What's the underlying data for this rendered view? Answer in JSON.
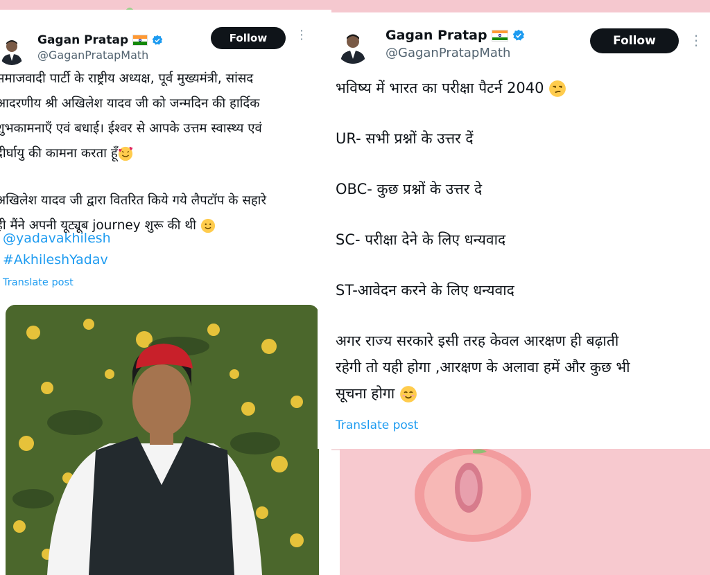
{
  "left_post": {
    "author_name": "Gagan Pratap",
    "handle": "@GaganPratapMath",
    "follow_label": "Follow",
    "more_label": "⋮",
    "paragraph1": [
      "समाजवादी पार्टी के राष्ट्रीय अध्यक्ष, पूर्व मुख्यमंत्री, सांसद",
      "आदरणीय श्री अखिलेश यादव जी को जन्मदिन की हार्दिक",
      "शुभकामनाएँ एवं बधाई। ईश्वर से आपके उत्तम स्वास्थ्य एवं",
      "दीर्घायु की कामना करता हूँ"
    ],
    "paragraph2": [
      "अखिलेश यादव जी द्वारा वितरित किये गये लैपटॉप के सहारे",
      "ही मैंने अपनी यूट्यूब journey शुरू की थी"
    ],
    "mention": "@yadavakhilesh",
    "hashtag": "#AkhileshYadav",
    "translate_label": "Translate post",
    "photo_icon": "person-photo"
  },
  "right_post": {
    "author_name": "Gagan Pratap",
    "handle": "@GaganPratapMath",
    "follow_label": "Follow",
    "more_label": "⋮",
    "line1": "भविष्य में भारत का परीक्षा पैटर्न 2040",
    "line2": "UR- सभी प्रश्नों के उत्तर दें",
    "line3": "OBC- कुछ प्रश्नों के उत्तर दे",
    "line4": "SC- परीक्षा देने के लिए धन्यवाद",
    "line5": "ST-आवेदन करने के लिए धन्यवाद",
    "closing": [
      "अगर राज्य सरकारे इसी तरह केवल आरक्षण ही बढ़ाती",
      "रहेगी तो यही होगा ,आरक्षण के अलावा हमें और कुछ भी",
      "सूचना होगा"
    ],
    "translate_label": "Translate post"
  },
  "icons": {
    "verified": "verified-badge-icon",
    "flag": "india-flag-icon",
    "emoji_love": "smiling-face-with-hearts-icon",
    "emoji_smile": "slightly-smiling-face-icon",
    "emoji_unamused": "unamused-face-icon",
    "emoji_blush": "smiling-face-icon"
  },
  "colors": {
    "link": "#1d9bf0",
    "follow_bg": "#0f1419",
    "handle": "#536471",
    "background_pink": "#f3d9dc"
  }
}
